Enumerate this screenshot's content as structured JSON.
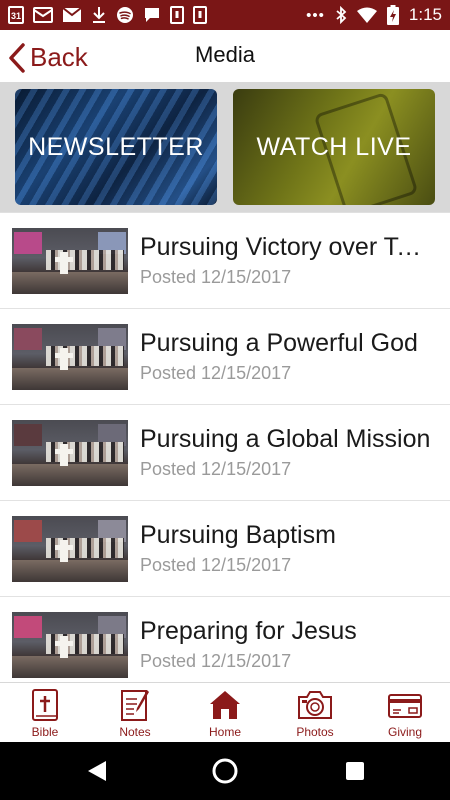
{
  "status_bar": {
    "calendar_day": "31",
    "time": "1:15",
    "left_icons": [
      "calendar-icon",
      "mail-icon",
      "email-icon",
      "download-icon",
      "spotify-icon",
      "chat-icon",
      "app-icon",
      "app-icon"
    ],
    "right_icons": [
      "more-dots-icon",
      "bluetooth-icon",
      "wifi-icon",
      "battery-icon"
    ],
    "background": "#7a1616"
  },
  "header": {
    "back_label": "Back",
    "title": "Media"
  },
  "banners": [
    {
      "label": "NEWSLETTER"
    },
    {
      "label": "WATCH LIVE"
    }
  ],
  "media_items": [
    {
      "title": "Pursuing Victory over Te…",
      "date": "Posted 12/15/2017"
    },
    {
      "title": "Pursuing a Powerful God",
      "date": "Posted 12/15/2017"
    },
    {
      "title": "Pursuing a Global Mission",
      "date": "Posted 12/15/2017"
    },
    {
      "title": "Pursuing Baptism",
      "date": "Posted 12/15/2017"
    },
    {
      "title": "Preparing for Jesus",
      "date": "Posted 12/15/2017"
    }
  ],
  "bottom_nav": [
    {
      "label": "Bible",
      "icon": "bible-icon"
    },
    {
      "label": "Notes",
      "icon": "notes-icon"
    },
    {
      "label": "Home",
      "icon": "home-icon"
    },
    {
      "label": "Photos",
      "icon": "camera-icon"
    },
    {
      "label": "Giving",
      "icon": "card-icon"
    }
  ],
  "colors": {
    "accent": "#8b1a1a",
    "status_bar": "#7a1616",
    "date_text": "#9a9a9a"
  }
}
